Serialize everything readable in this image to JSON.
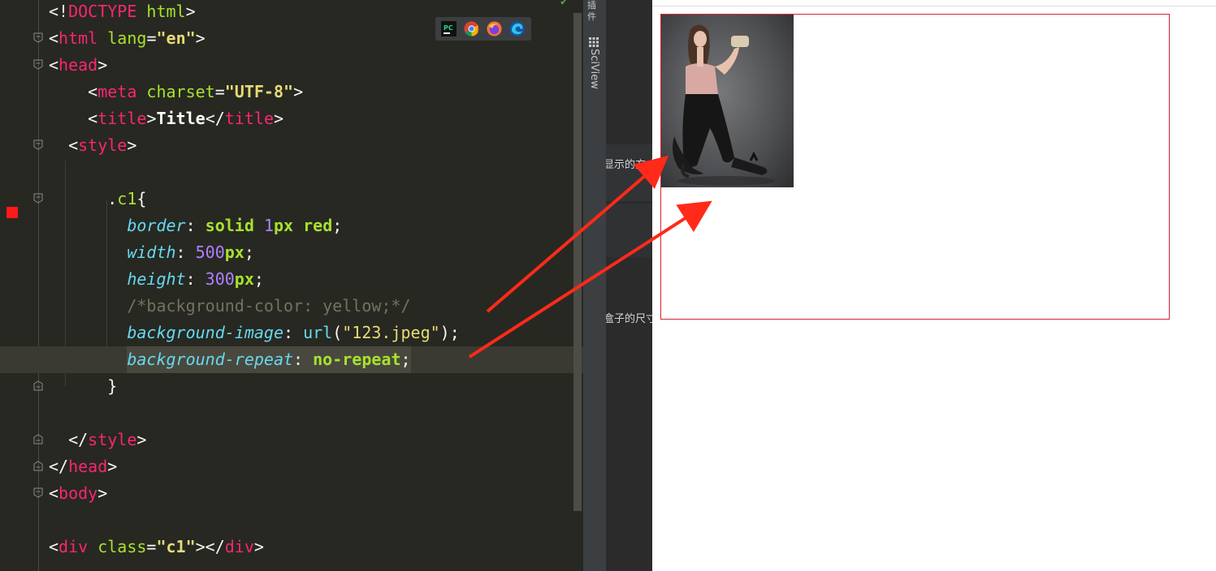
{
  "editor": {
    "lines": [
      {
        "k": "doctype",
        "parts": [
          [
            "pun",
            "<!"
          ],
          [
            "tag",
            "DOCTYPE"
          ],
          [
            "attr",
            " html"
          ],
          [
            "pun",
            ">"
          ]
        ]
      },
      {
        "k": "html",
        "parts": [
          [
            "pun",
            "<"
          ],
          [
            "tag",
            "html"
          ],
          [
            "attr",
            " lang"
          ],
          [
            "pun",
            "="
          ],
          [
            "str",
            "\"en\""
          ],
          [
            "pun",
            ">"
          ]
        ]
      },
      {
        "k": "head",
        "parts": [
          [
            "pun",
            "<"
          ],
          [
            "tag",
            "head"
          ],
          [
            "pun",
            ">"
          ]
        ]
      },
      {
        "k": "meta",
        "parts": [
          [
            "pun",
            "    <"
          ],
          [
            "tag",
            "meta"
          ],
          [
            "attr",
            " charset"
          ],
          [
            "pun",
            "="
          ],
          [
            "str",
            "\"UTF-8\""
          ],
          [
            "pun",
            ">"
          ]
        ]
      },
      {
        "k": "title",
        "parts": [
          [
            "pun",
            "    <"
          ],
          [
            "tag",
            "title"
          ],
          [
            "pun",
            ">"
          ],
          [
            "bold",
            "Title"
          ],
          [
            "pun",
            "</"
          ],
          [
            "tag",
            "title"
          ],
          [
            "pun",
            ">"
          ]
        ]
      },
      {
        "k": "style",
        "parts": [
          [
            "pun",
            "  <"
          ],
          [
            "tag",
            "style"
          ],
          [
            "pun",
            ">"
          ]
        ]
      },
      {
        "k": "blank1",
        "parts": []
      },
      {
        "k": "c1",
        "parts": [
          [
            "pun",
            "      "
          ],
          [
            "pun",
            "."
          ],
          [
            "clsname",
            "c1"
          ],
          [
            "pun",
            "{"
          ]
        ]
      },
      {
        "k": "border",
        "parts": [
          [
            "pun",
            "        "
          ],
          [
            "prop",
            "border"
          ],
          [
            "pun",
            ": "
          ],
          [
            "kw",
            "solid"
          ],
          [
            "pun",
            " "
          ],
          [
            "num",
            "1"
          ],
          [
            "unit",
            "px"
          ],
          [
            "pun",
            " "
          ],
          [
            "kw",
            "red"
          ],
          [
            "pun",
            ";"
          ]
        ]
      },
      {
        "k": "width",
        "parts": [
          [
            "pun",
            "        "
          ],
          [
            "prop",
            "width"
          ],
          [
            "pun",
            ": "
          ],
          [
            "num",
            "500"
          ],
          [
            "unit",
            "px"
          ],
          [
            "pun",
            ";"
          ]
        ]
      },
      {
        "k": "height",
        "parts": [
          [
            "pun",
            "        "
          ],
          [
            "prop",
            "height"
          ],
          [
            "pun",
            ": "
          ],
          [
            "num",
            "300"
          ],
          [
            "unit",
            "px"
          ],
          [
            "pun",
            ";"
          ]
        ]
      },
      {
        "k": "comment",
        "parts": [
          [
            "pun",
            "        "
          ],
          [
            "cmt",
            "/*background-color: yellow;*/"
          ]
        ]
      },
      {
        "k": "bgimg",
        "parts": [
          [
            "pun",
            "        "
          ],
          [
            "prop",
            "background-image"
          ],
          [
            "pun",
            ": "
          ],
          [
            "fn",
            "url"
          ],
          [
            "pun",
            "("
          ],
          [
            "strn",
            "\"123.jpeg\""
          ],
          [
            "pun",
            ");"
          ]
        ]
      },
      {
        "k": "bgrep",
        "parts": [
          [
            "pun",
            "        "
          ],
          [
            "sel_start",
            ""
          ],
          [
            "prop",
            "background-repeat"
          ],
          [
            "pun",
            ": "
          ],
          [
            "kw",
            "no-repeat"
          ],
          [
            "pun",
            ";"
          ],
          [
            "sel_end",
            ""
          ]
        ]
      },
      {
        "k": "close",
        "parts": [
          [
            "pun",
            "      }"
          ]
        ]
      },
      {
        "k": "blank2",
        "parts": []
      },
      {
        "k": "estyle",
        "parts": [
          [
            "pun",
            "  </"
          ],
          [
            "tag",
            "style"
          ],
          [
            "pun",
            ">"
          ]
        ]
      },
      {
        "k": "ehead",
        "parts": [
          [
            "pun",
            "</"
          ],
          [
            "tag",
            "head"
          ],
          [
            "pun",
            ">"
          ]
        ]
      },
      {
        "k": "body",
        "parts": [
          [
            "pun",
            "<"
          ],
          [
            "tag",
            "body"
          ],
          [
            "pun",
            ">"
          ]
        ]
      },
      {
        "k": "blank3",
        "parts": []
      },
      {
        "k": "div",
        "parts": [
          [
            "pun",
            "<"
          ],
          [
            "tag",
            "div"
          ],
          [
            "attr",
            " class"
          ],
          [
            "pun",
            "="
          ],
          [
            "str",
            "\"c1\""
          ],
          [
            "pun",
            "></"
          ],
          [
            "tag",
            "div"
          ],
          [
            "pun",
            ">"
          ]
        ]
      }
    ]
  },
  "toolstrip": {
    "top_label": "插件",
    "sciview_label": "SciView"
  },
  "docpeek": {
    "text_1": "显示的方式",
    "text_2": "盒子的尺寸"
  },
  "browser_icons": [
    "pycharm-icon",
    "chrome-icon",
    "firefox-icon",
    "edge-icon"
  ],
  "colors": {
    "editor_bg": "#272822",
    "preview_border": "#d4232f",
    "arrow": "#ff2a1a"
  }
}
